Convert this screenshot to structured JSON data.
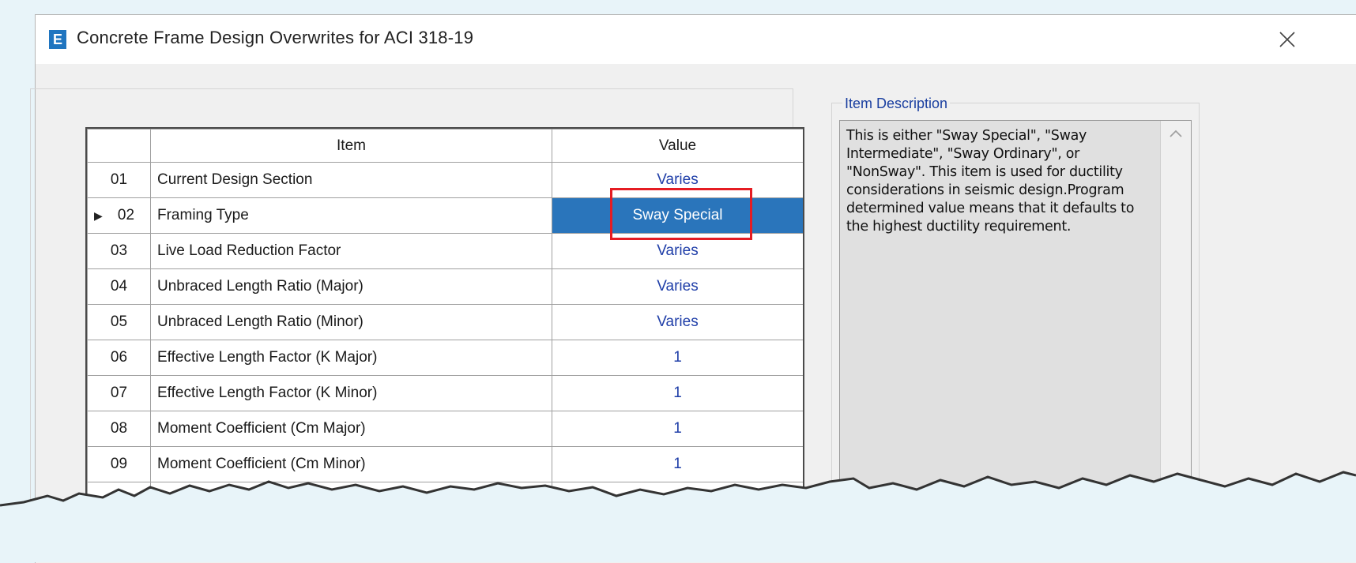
{
  "window": {
    "title": "Concrete Frame Design Overwrites for ACI 318-19",
    "icon_letter": "E"
  },
  "grid": {
    "columns": [
      "",
      "Item",
      "Value"
    ],
    "rows": [
      {
        "num": "01",
        "item": "Current Design Section",
        "value": "Varies",
        "selected": false
      },
      {
        "num": "02",
        "item": "Framing Type",
        "value": "Sway Special",
        "selected": true
      },
      {
        "num": "03",
        "item": "Live Load Reduction Factor",
        "value": "Varies",
        "selected": false
      },
      {
        "num": "04",
        "item": "Unbraced Length Ratio (Major)",
        "value": "Varies",
        "selected": false
      },
      {
        "num": "05",
        "item": "Unbraced Length Ratio (Minor)",
        "value": "Varies",
        "selected": false
      },
      {
        "num": "06",
        "item": "Effective Length Factor (K Major)",
        "value": "1",
        "selected": false
      },
      {
        "num": "07",
        "item": "Effective Length Factor (K Minor)",
        "value": "1",
        "selected": false
      },
      {
        "num": "08",
        "item": "Moment Coefficient (Cm Major)",
        "value": "1",
        "selected": false
      },
      {
        "num": "09",
        "item": "Moment Coefficient (Cm Minor)",
        "value": "1",
        "selected": false
      }
    ]
  },
  "description": {
    "label": "Item Description",
    "text": "This is either \"Sway Special\", \"Sway Intermediate\", \"Sway Ordinary\", or \"NonSway\".  This item is used for ductility considerations in seismic design.Program determined value means that it defaults to the highest ductility requirement."
  },
  "colors": {
    "selection": "#2a75bb",
    "value_text": "#1f3ea8",
    "highlight_box": "#e51c23",
    "background": "#e8f4f9"
  },
  "icons": {
    "close": "close-icon",
    "row_pointer": "row-pointer-icon",
    "scroll_up": "chevron-up-icon"
  }
}
